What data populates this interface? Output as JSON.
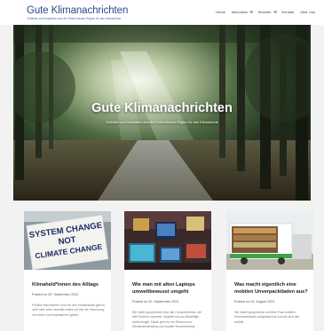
{
  "header": {
    "title": "Gute Klimanachrichten",
    "tagline": "Vorbilder und Inspiration aus der Rhein-Neckar Region für den Klimaschutz",
    "nav": [
      {
        "label": "Home",
        "has_dropdown": false
      },
      {
        "label": "Interviews",
        "has_dropdown": true
      },
      {
        "label": "Berichte",
        "has_dropdown": true
      },
      {
        "label": "Kontakt",
        "has_dropdown": false
      },
      {
        "label": "Über Uns",
        "has_dropdown": false
      }
    ]
  },
  "hero": {
    "title": "Gute Klimanachrichten",
    "subtitle": "Vorbilder und Inspiration aus der Rhein-Neckar Region für den Klimaschutz"
  },
  "cards": [
    {
      "title": "Klimaheld*innen des Alltags",
      "date": "Posted on 29. September 2021",
      "excerpt": "Positive Nachrichten rund um den Klimawandel gibt es nicht sehr viele, deshalb wollen wir hier ein Sammlung von Ideen und Inspirationen geben.",
      "sign_line1": "SYSTEM CHANGE",
      "sign_line2": "NOT",
      "sign_line3": "CLIMATE CHANGE"
    },
    {
      "title": "Wie man mit alten Laptops umweltbewusst umgeht",
      "date": "Posted on 20. September 2021",
      "excerpt": "Wir haben gesprochen über die Computerbörse, die alte Rechner sammelt, repariert und an Bedürftige weitervergibt. Dabei geht es um Ressourcen, Wiederverwendung und soziale Verantwortung."
    },
    {
      "title": "Was macht eigentlich eine mobilen Unverpacktladen aus?",
      "date": "Posted on 24. August 2021",
      "excerpt": "Wir haben gesprochen mit einer Frau mobilen Unverpacktladen aufgebaut hat und wie sich das anfühlt."
    }
  ],
  "colors": {
    "brand": "#2b4a8b",
    "background": "#f2f2f2"
  }
}
